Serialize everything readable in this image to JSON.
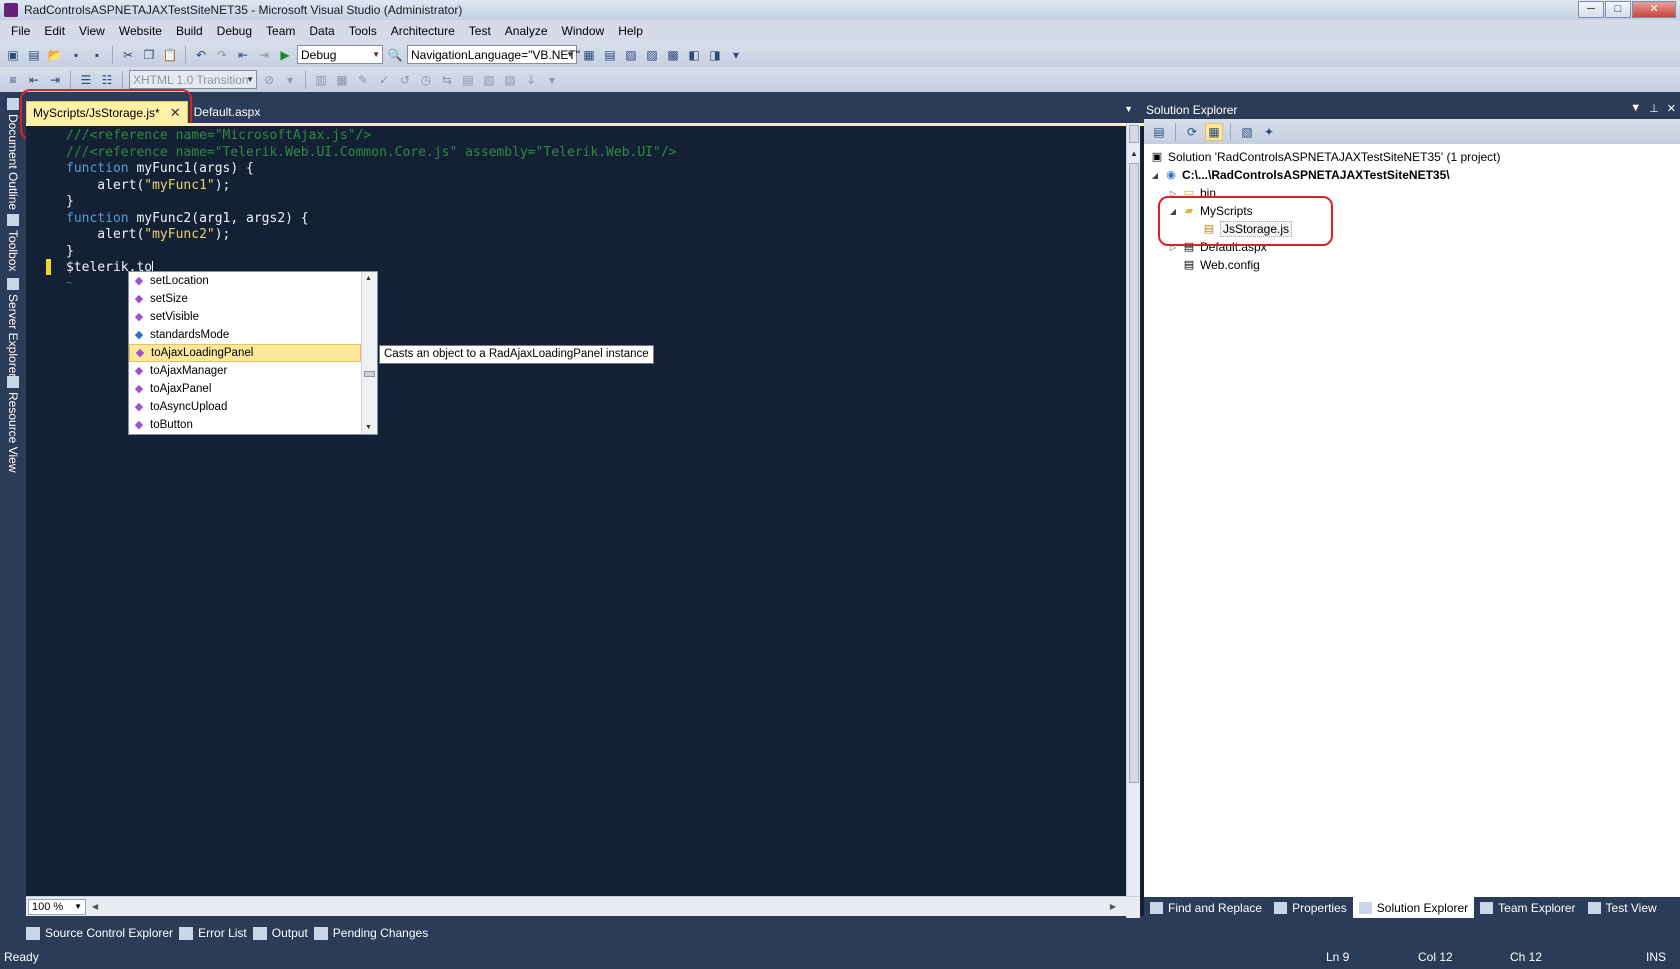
{
  "window": {
    "title": "RadControlsASPNETAJAXTestSiteNET35 - Microsoft Visual Studio (Administrator)",
    "minimize": "─",
    "restore": "□",
    "close": "✕"
  },
  "menu": [
    "File",
    "Edit",
    "View",
    "Website",
    "Build",
    "Debug",
    "Team",
    "Data",
    "Tools",
    "Architecture",
    "Test",
    "Analyze",
    "Window",
    "Help"
  ],
  "toolbar": {
    "config": "Debug",
    "property": "NavigationLanguage=\"VB.NET\"",
    "schema": "XHTML 1.0 Transition"
  },
  "side_tabs": [
    "Document Outline",
    "Toolbox",
    "Server Explorer",
    "Resource View"
  ],
  "doc_tabs": {
    "active": "MyScripts/JsStorage.js*",
    "close": "✕",
    "inactive": "Default.aspx"
  },
  "code": {
    "line1": "///<reference name=\"MicrosoftAjax.js\"/>",
    "line2": "///<reference name=\"Telerik.Web.UI.Common.Core.js\" assembly=\"Telerik.Web.UI\"/>",
    "kw_function": "function",
    "func1_sig": " myFunc1(args) {",
    "alert1_pre": "    alert(",
    "alert1_str": "\"myFunc1\"",
    "alert_post": ");",
    "close_brace": "}",
    "func2_sig": " myFunc2(arg1, args2) {",
    "alert2_str": "\"myFunc2\"",
    "typing": "$telerik.to",
    "squiggle": "~"
  },
  "intellisense": {
    "items": [
      {
        "label": "setLocation",
        "kind": "method"
      },
      {
        "label": "setSize",
        "kind": "method"
      },
      {
        "label": "setVisible",
        "kind": "method"
      },
      {
        "label": "standardsMode",
        "kind": "property"
      },
      {
        "label": "toAjaxLoadingPanel",
        "kind": "method",
        "selected": true
      },
      {
        "label": "toAjaxManager",
        "kind": "method"
      },
      {
        "label": "toAjaxPanel",
        "kind": "method"
      },
      {
        "label": "toAsyncUpload",
        "kind": "method"
      },
      {
        "label": "toButton",
        "kind": "method"
      }
    ],
    "tooltip": "Casts an object to a RadAjaxLoadingPanel instance"
  },
  "editor": {
    "zoom": "100 %"
  },
  "solution_explorer": {
    "title": "Solution Explorer",
    "solution": "Solution 'RadControlsASPNETAJAXTestSiteNET35' (1 project)",
    "project": "C:\\...\\RadControlsASPNETAJAXTestSiteNET35\\",
    "bin": "bin",
    "myscripts": "MyScripts",
    "jsstorage": "JsStorage.js",
    "default_aspx": "Default.aspx",
    "web_config": "Web.config"
  },
  "right_tabs": [
    "Find and Replace",
    "Properties",
    "Solution Explorer",
    "Team Explorer",
    "Test View"
  ],
  "bottom_tabs": [
    "Source Control Explorer",
    "Error List",
    "Output",
    "Pending Changes"
  ],
  "status": {
    "state": "Ready",
    "ln": "Ln 9",
    "col": "Col 12",
    "ch": "Ch 12",
    "mode": "INS"
  },
  "colors": {
    "chrome": "#2b3c59",
    "editor_bg": "#142034",
    "highlight": "#fff1a8",
    "annotation": "#e02020"
  }
}
